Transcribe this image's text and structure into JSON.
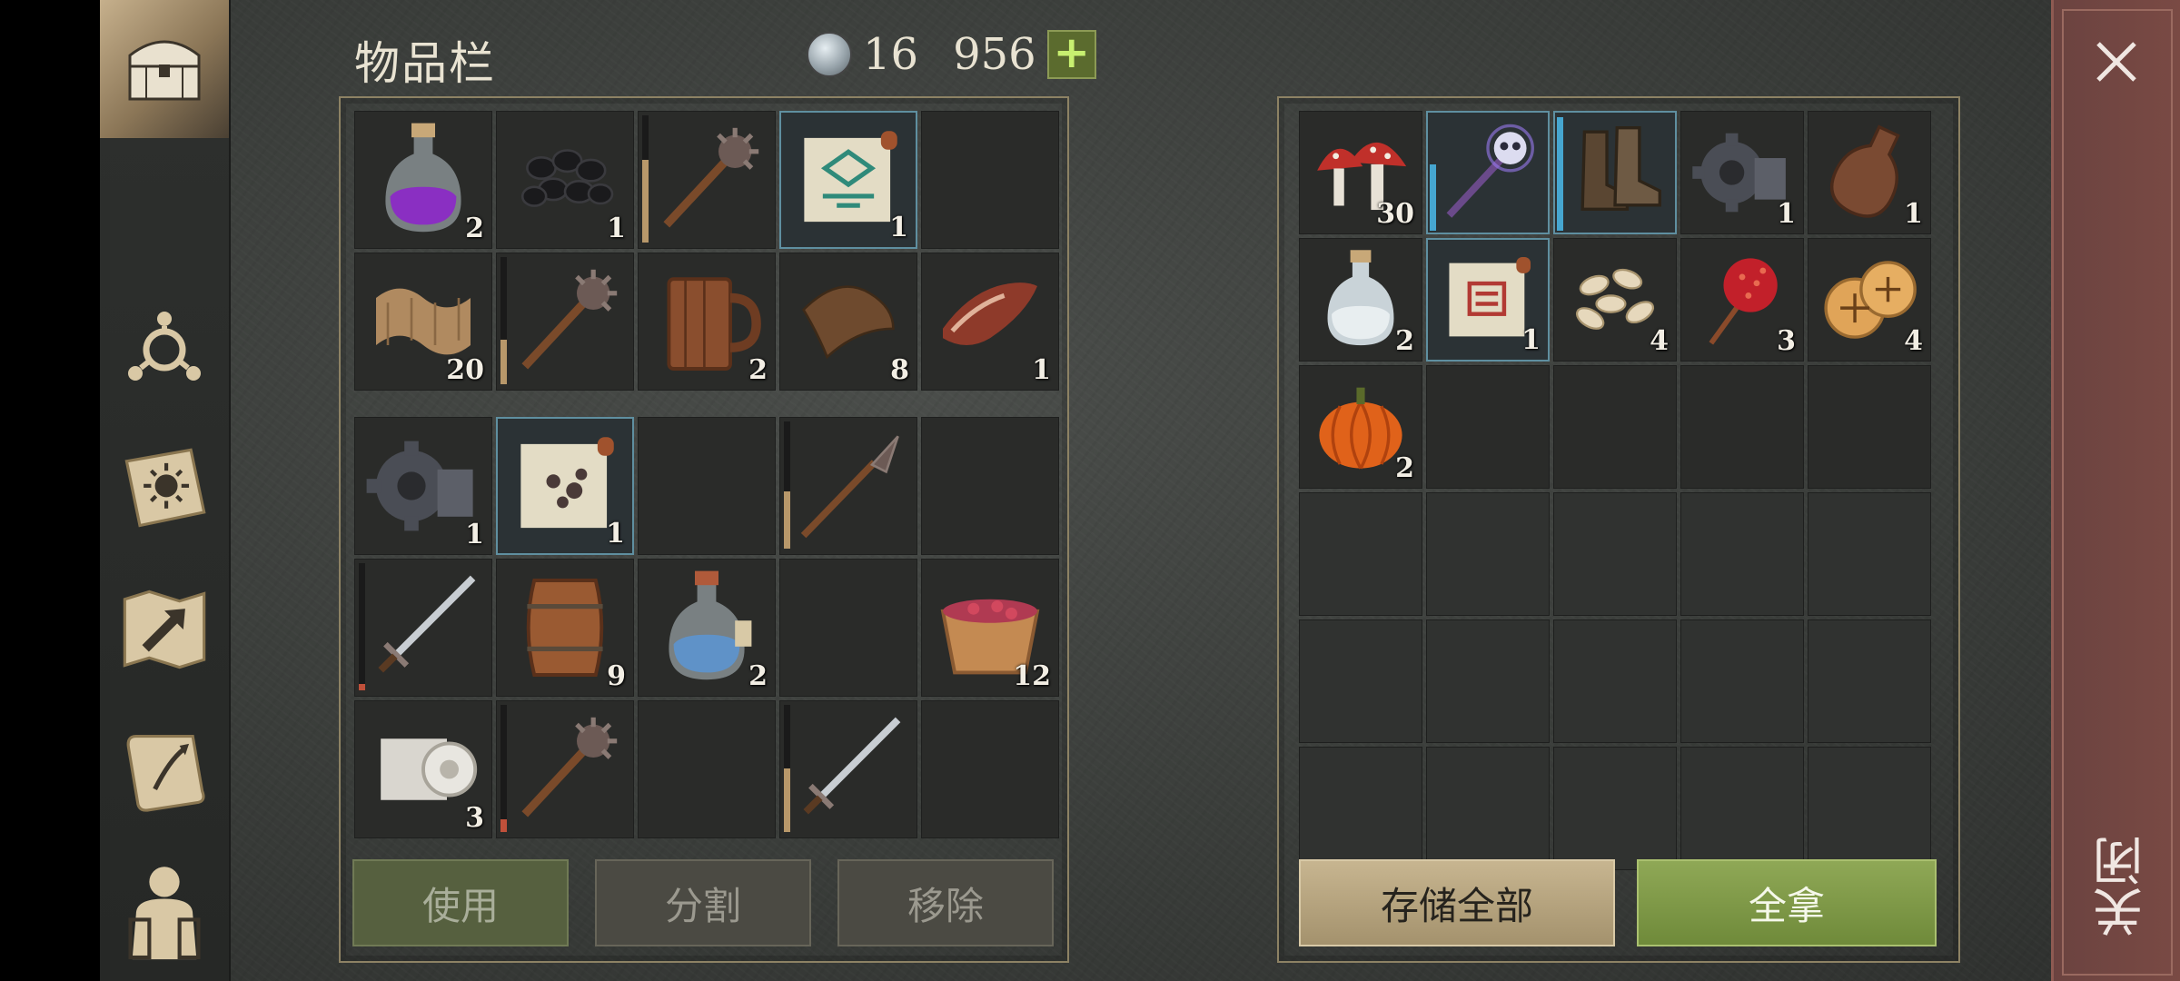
{
  "title": "物品栏",
  "currency": {
    "first": "16",
    "second": "956",
    "plus": "+"
  },
  "inventory_top": [
    {
      "icon": "purple-potion-icon",
      "count": "2",
      "highlight": false
    },
    {
      "icon": "coal-icon",
      "count": "1",
      "highlight": false
    },
    {
      "icon": "mace-icon",
      "count": "",
      "highlight": false,
      "durability": 0.65,
      "durability_color": "#b8986a"
    },
    {
      "icon": "green-recipe-scroll-icon",
      "count": "1",
      "highlight": true
    },
    {
      "icon": "",
      "count": "",
      "highlight": false
    },
    {
      "icon": "cloth-icon",
      "count": "20",
      "highlight": false
    },
    {
      "icon": "mace-icon",
      "count": "",
      "highlight": false,
      "durability": 0.35,
      "durability_color": "#b8986a"
    },
    {
      "icon": "wooden-mug-icon",
      "count": "2",
      "highlight": false
    },
    {
      "icon": "leather-icon",
      "count": "8",
      "highlight": false
    },
    {
      "icon": "bacon-icon",
      "count": "1",
      "highlight": false
    }
  ],
  "inventory_bottom": [
    {
      "icon": "gear-icon",
      "count": "1",
      "highlight": false
    },
    {
      "icon": "dark-recipe-scroll-icon",
      "count": "1",
      "highlight": true
    },
    {
      "icon": "",
      "count": "",
      "highlight": false
    },
    {
      "icon": "spear-icon",
      "count": "",
      "highlight": false,
      "durability": 0.45,
      "durability_color": "#b8986a"
    },
    {
      "icon": "",
      "count": "",
      "highlight": false
    },
    {
      "icon": "sword-icon",
      "count": "",
      "highlight": false,
      "durability": 0.05,
      "durability_color": "#c0503a"
    },
    {
      "icon": "barrel-icon",
      "count": "9",
      "highlight": false
    },
    {
      "icon": "blue-potion-icon",
      "count": "2",
      "highlight": false
    },
    {
      "icon": "",
      "count": "",
      "highlight": false
    },
    {
      "icon": "berry-bowl-icon",
      "count": "12",
      "highlight": false
    },
    {
      "icon": "bandage-roll-icon",
      "count": "3",
      "highlight": false
    },
    {
      "icon": "mace-icon",
      "count": "",
      "highlight": false,
      "durability": 0.1,
      "durability_color": "#c0503a"
    },
    {
      "icon": "",
      "count": "",
      "highlight": false
    },
    {
      "icon": "sword-icon",
      "count": "",
      "highlight": false,
      "durability": 0.5,
      "durability_color": "#b8986a"
    },
    {
      "icon": "",
      "count": "",
      "highlight": false
    }
  ],
  "storage": [
    {
      "icon": "mushroom-icon",
      "count": "30",
      "highlight": false
    },
    {
      "icon": "skull-staff-icon",
      "count": "",
      "highlight": true,
      "blue": 0.55
    },
    {
      "icon": "boots-icon",
      "count": "",
      "highlight": true,
      "blue": 0.95
    },
    {
      "icon": "gear-icon",
      "count": "1",
      "highlight": false
    },
    {
      "icon": "leather-flask-icon",
      "count": "1",
      "highlight": false
    },
    {
      "icon": "white-potion-icon",
      "count": "2",
      "highlight": false
    },
    {
      "icon": "red-recipe-scroll-icon",
      "count": "1",
      "highlight": true
    },
    {
      "icon": "seeds-icon",
      "count": "4",
      "highlight": false
    },
    {
      "icon": "candy-apple-icon",
      "count": "3",
      "highlight": false
    },
    {
      "icon": "cookies-icon",
      "count": "4",
      "highlight": false
    },
    {
      "icon": "pumpkin-icon",
      "count": "2",
      "highlight": false
    }
  ],
  "buttons": {
    "use": "使用",
    "split": "分割",
    "remove": "移除",
    "store_all": "存储全部",
    "take_all": "全拿"
  },
  "close_label": "关闭",
  "colors": {
    "slot": "#2a2b29",
    "highlight": "#5f8fa0",
    "take_button": "#7e9848",
    "store_button": "#b5a37e",
    "close_strip": "#74463f"
  }
}
